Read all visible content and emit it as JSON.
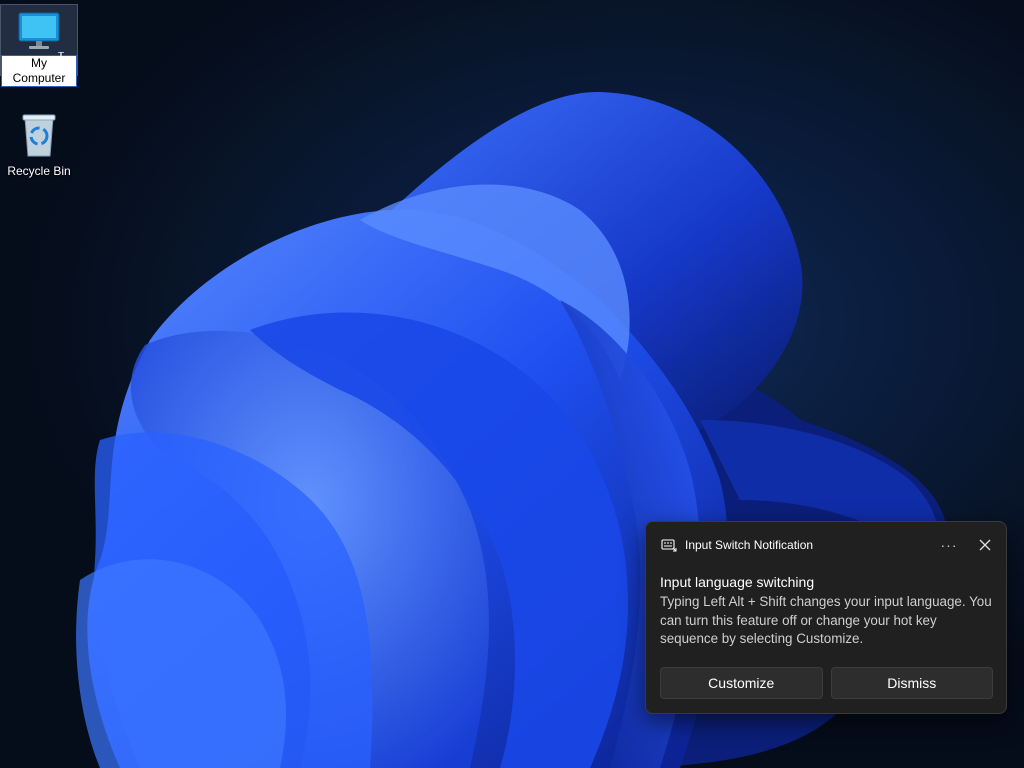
{
  "desktop": {
    "icons": [
      {
        "label_before": "My Comp",
        "label_selected": "u",
        "label_after": "ter",
        "icon": "monitor-icon"
      },
      {
        "label": "Recycle Bin",
        "icon": "recycle-bin-icon"
      }
    ]
  },
  "notification": {
    "app_icon": "keyboard-icon",
    "app_name": "Input Switch Notification",
    "more_icon": "more-options-icon",
    "more_label": "···",
    "close_icon": "close-icon",
    "title": "Input language switching",
    "body": "Typing Left Alt + Shift changes your input language. You can turn this feature off or change your hot key sequence by selecting Customize.",
    "buttons": [
      {
        "label": "Customize"
      },
      {
        "label": "Dismiss"
      }
    ]
  },
  "colors": {
    "toast_bg": "#202020",
    "button_bg": "#2d2d2d",
    "wallpaper_blue": "#1f4ff0",
    "desktop_bg": "#0a1c3c"
  }
}
